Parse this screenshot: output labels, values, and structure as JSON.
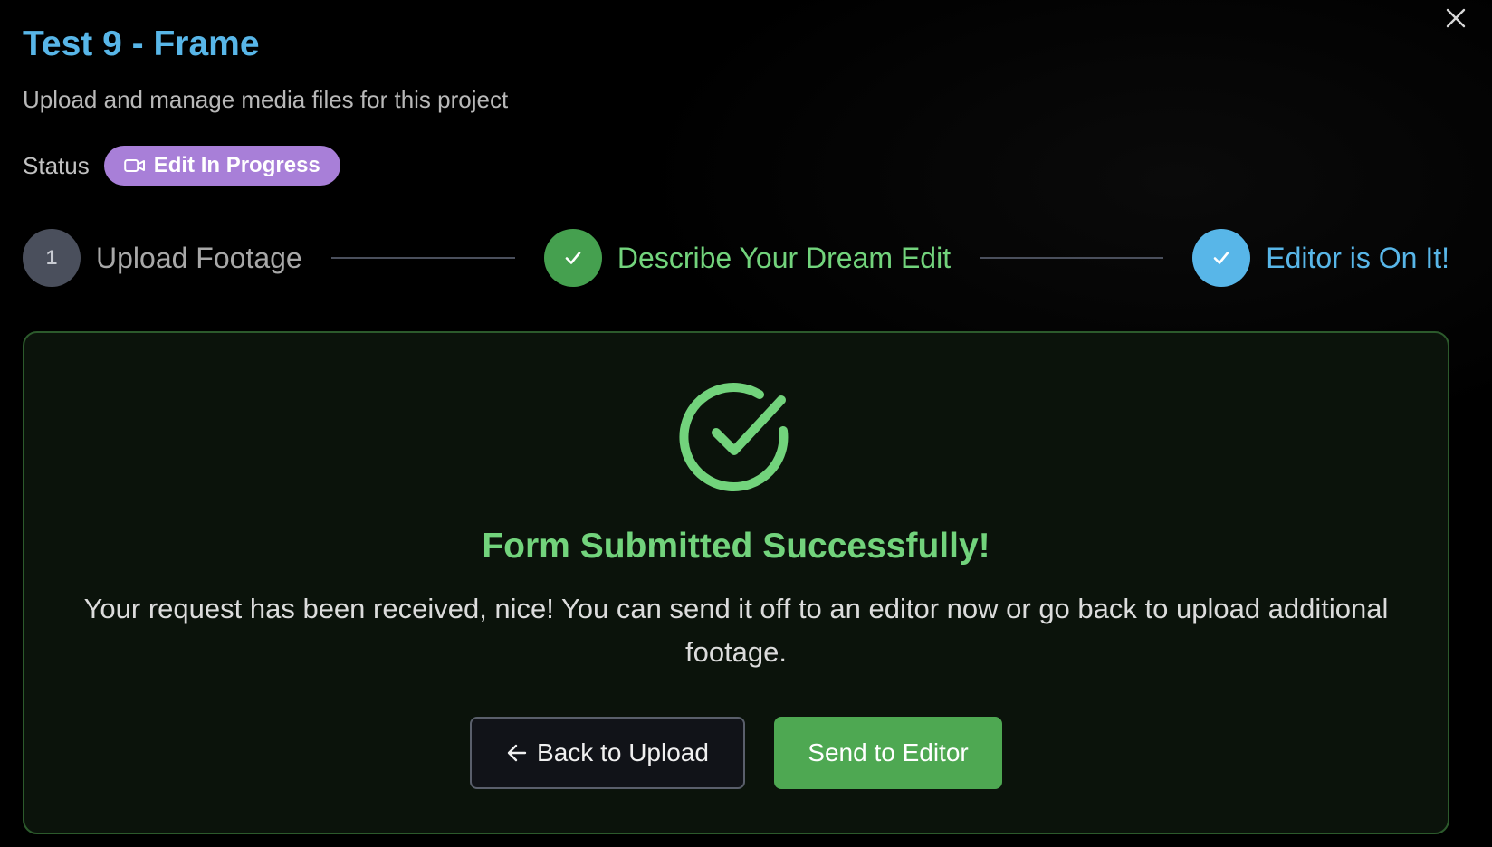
{
  "modal": {
    "title": "Test 9 - Frame",
    "subtitle": "Upload and manage media files for this project",
    "close_icon": "close-icon"
  },
  "status": {
    "label": "Status",
    "badge_text": "Edit In Progress",
    "badge_icon": "video-camera-icon",
    "badge_color": "#a87fd8"
  },
  "stepper": {
    "steps": [
      {
        "number": "1",
        "label": "Upload Footage",
        "state": "pending",
        "color": "#a8a8a8"
      },
      {
        "number": "",
        "label": "Describe Your Dream Edit",
        "state": "complete",
        "color": "#72d37c"
      },
      {
        "number": "",
        "label": "Editor is On It!",
        "state": "complete",
        "color": "#58b6e8"
      }
    ]
  },
  "success": {
    "icon": "check-circle-icon",
    "title": "Form Submitted Successfully!",
    "message": "Your request has been received, nice! You can send it off to an editor now or go back to upload additional footage.",
    "accent_color": "#72d37c"
  },
  "actions": {
    "back_label": "Back to Upload",
    "back_icon": "arrow-left-icon",
    "send_label": "Send to Editor",
    "send_color": "#4ea852"
  }
}
